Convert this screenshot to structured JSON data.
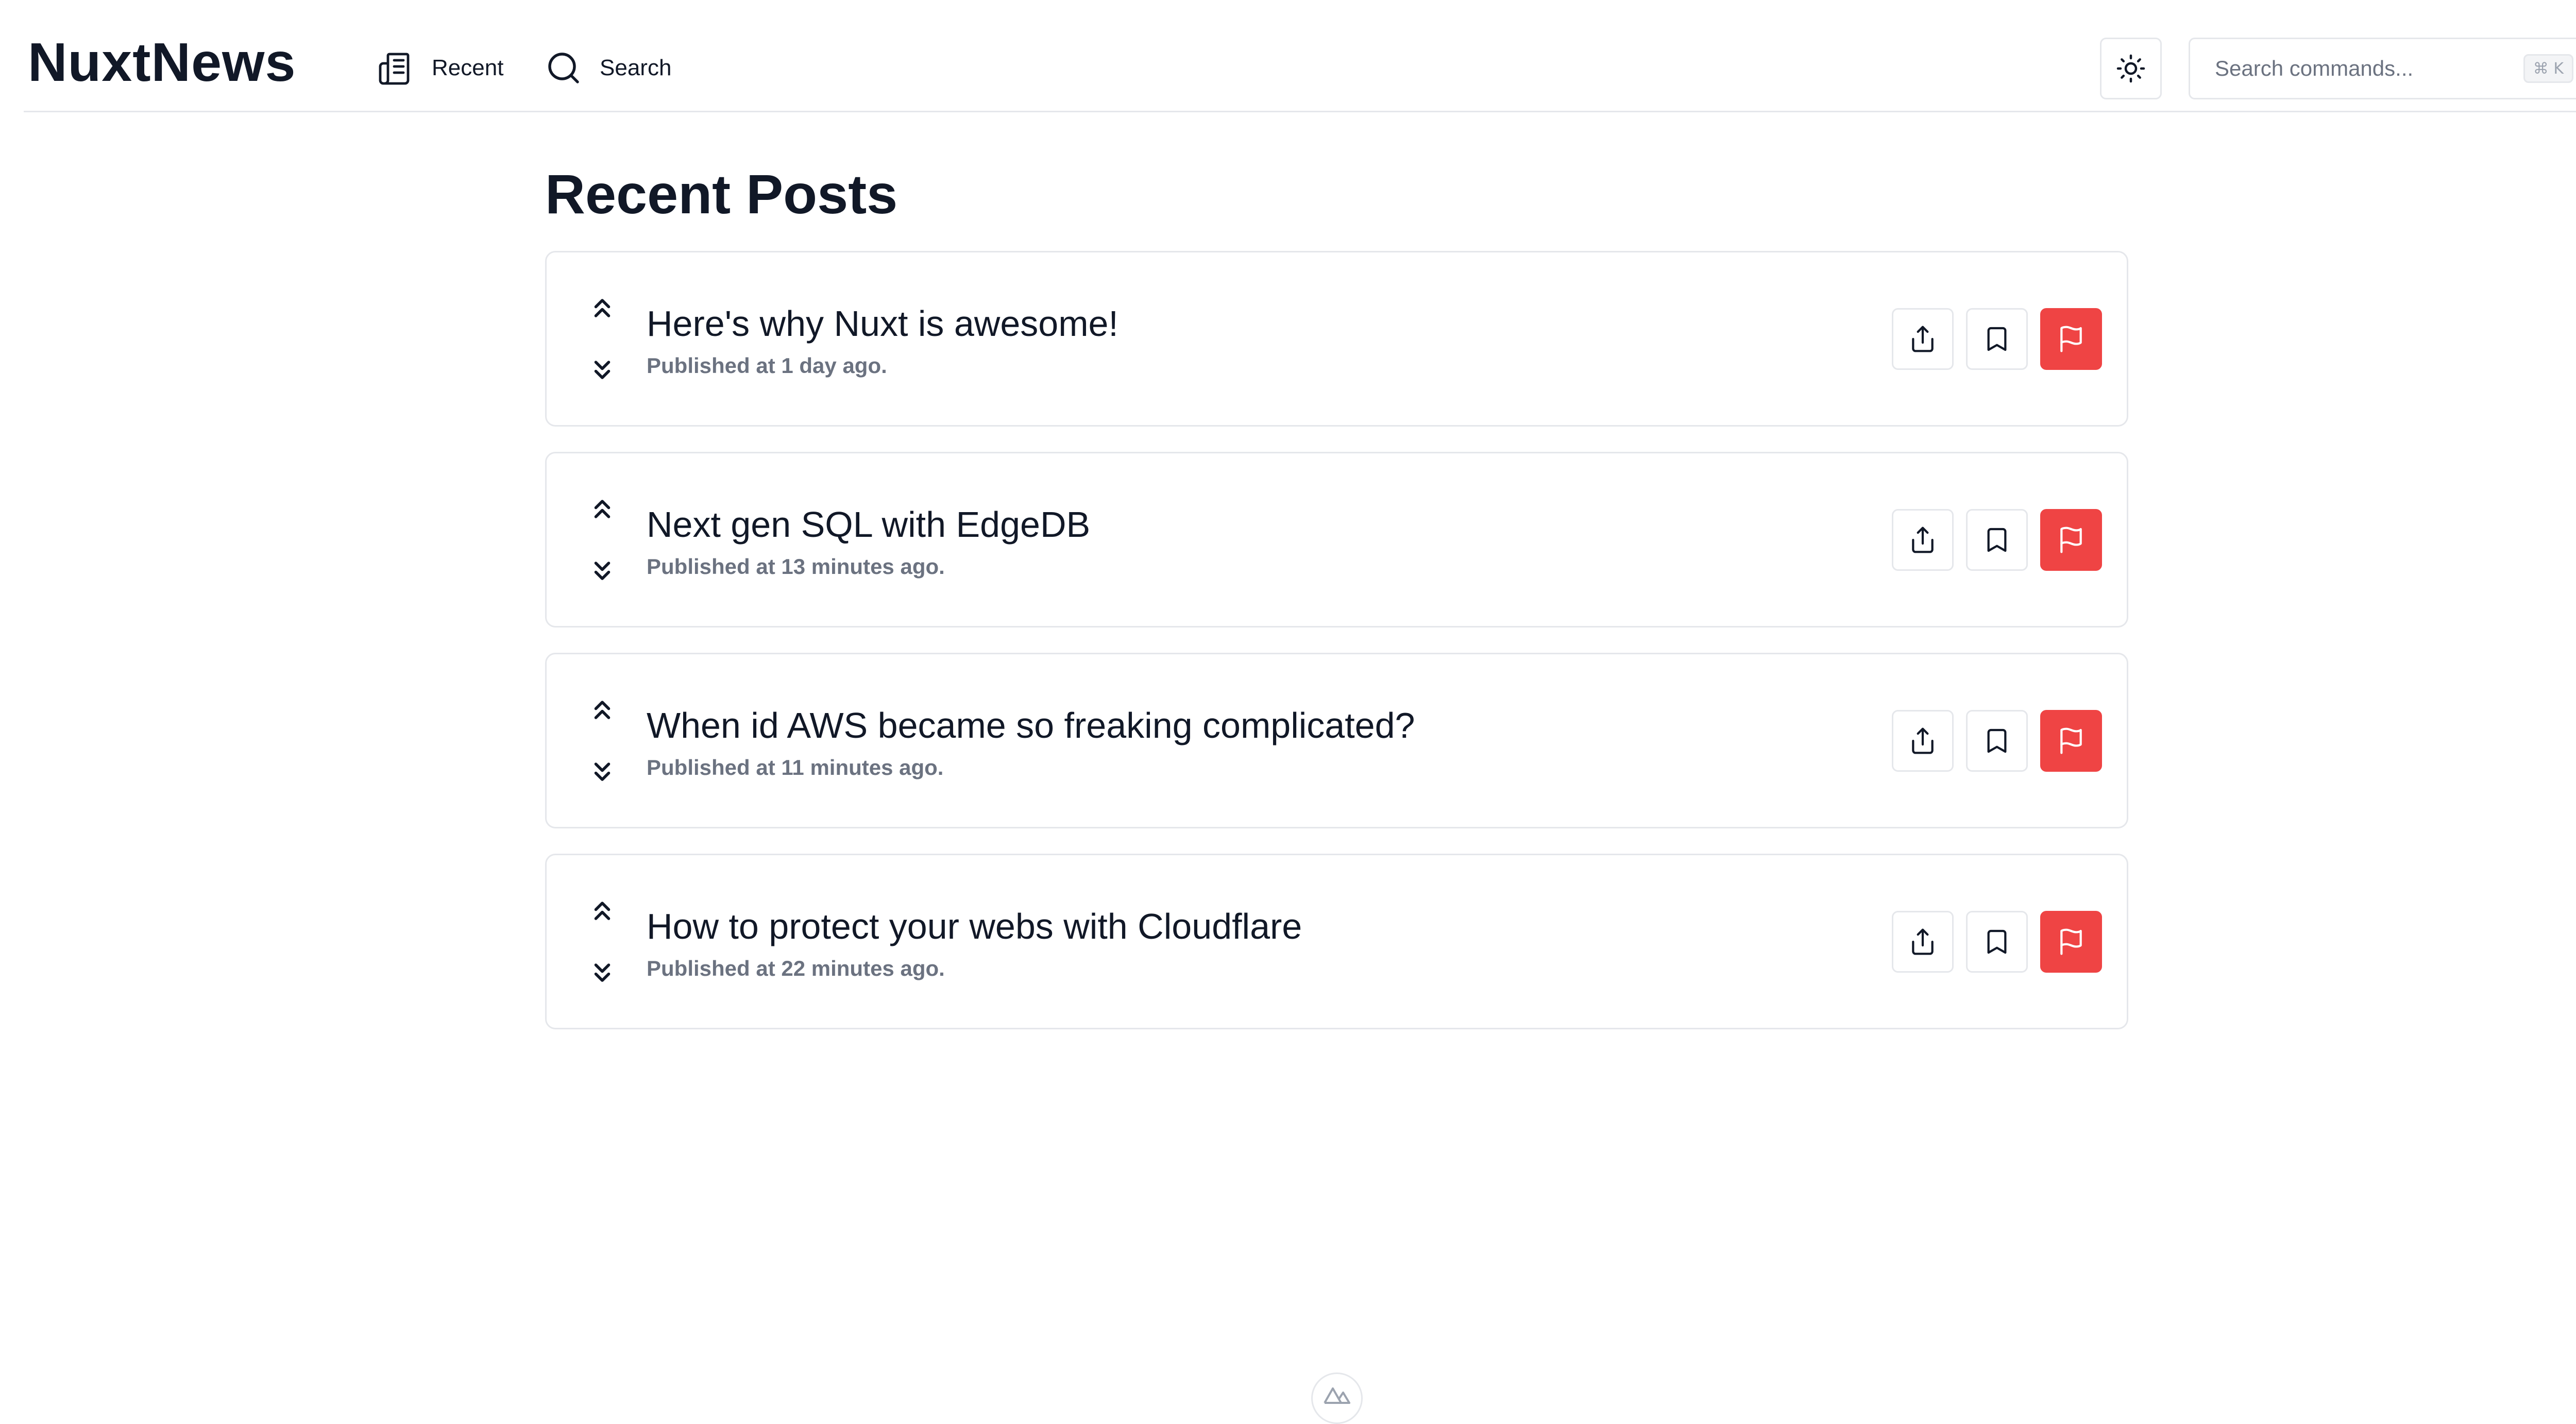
{
  "header": {
    "brand": "NuxtNews",
    "nav": [
      {
        "label": "Recent",
        "icon": "newspaper-icon"
      },
      {
        "label": "Search",
        "icon": "search-icon"
      }
    ],
    "theme_toggle_icon": "sun-icon",
    "command_search": {
      "placeholder": "Search commands...",
      "shortcut": "⌘ K"
    },
    "avatar_icon": "user-avatar"
  },
  "main": {
    "title": "Recent Posts",
    "posts": [
      {
        "title": "Here's why Nuxt is awesome!",
        "meta": "Published at 1 day ago."
      },
      {
        "title": "Next gen SQL with EdgeDB",
        "meta": "Published at 13 minutes ago."
      },
      {
        "title": "When id AWS became so freaking complicated?",
        "meta": "Published at 11 minutes ago."
      },
      {
        "title": "How to protect your webs with Cloudflare",
        "meta": "Published at 22 minutes ago."
      }
    ],
    "post_actions": [
      "share-icon",
      "bookmark-icon",
      "flag-icon"
    ]
  },
  "footer": {
    "logo_icon": "nuxt-logo-icon"
  },
  "colors": {
    "accent_danger": "#ef4444",
    "border": "#e5e7eb",
    "text": "#111827",
    "muted": "#6b7280"
  }
}
